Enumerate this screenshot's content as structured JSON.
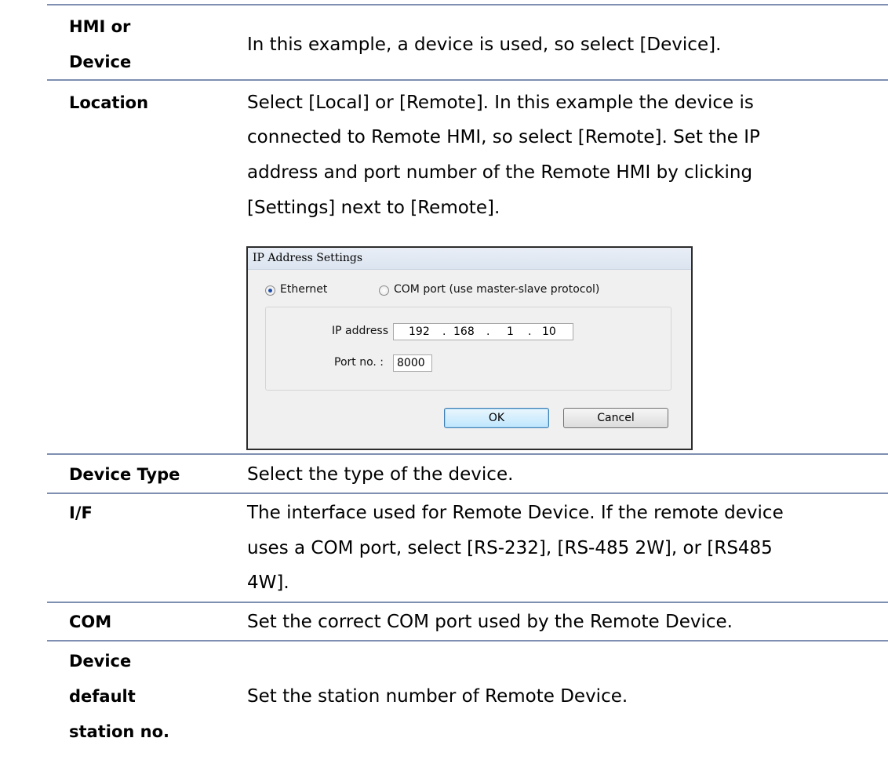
{
  "rows": [
    {
      "term_lines": [
        "HMI or",
        "Device"
      ],
      "desc_lines": [
        "In this example, a device is used, so select [Device]."
      ]
    },
    {
      "term_lines": [
        "Location"
      ],
      "desc_lines": [
        "Select [Local] or [Remote]. In this example the device is",
        "connected to Remote HMI, so select [Remote]. Set the IP",
        "address and port number of the Remote HMI by clicking",
        "[Settings] next to [Remote]."
      ]
    },
    {
      "term_lines": [
        "Device Type"
      ],
      "desc_lines": [
        "Select the type of the device."
      ]
    },
    {
      "term_lines": [
        "I/F"
      ],
      "desc_lines": [
        "The interface used for Remote Device. If the remote device",
        "uses a COM port, select [RS-232], [RS-485 2W], or [RS485",
        "4W]."
      ]
    },
    {
      "term_lines": [
        "COM"
      ],
      "desc_lines": [
        "Set the correct COM port used by the Remote Device."
      ]
    },
    {
      "term_lines": [
        "Device",
        "default",
        "station no."
      ],
      "desc_lines": [
        "Set the station number of Remote Device."
      ]
    }
  ],
  "dialog": {
    "title": "IP Address Settings",
    "radio_ethernet": "Ethernet",
    "radio_com": "COM port (use master-slave protocol)",
    "ip_label": "IP address :",
    "ip": [
      "192",
      "168",
      "1",
      "10"
    ],
    "port_label": "Port no. :",
    "port": "8000",
    "ok": "OK",
    "cancel": "Cancel"
  }
}
